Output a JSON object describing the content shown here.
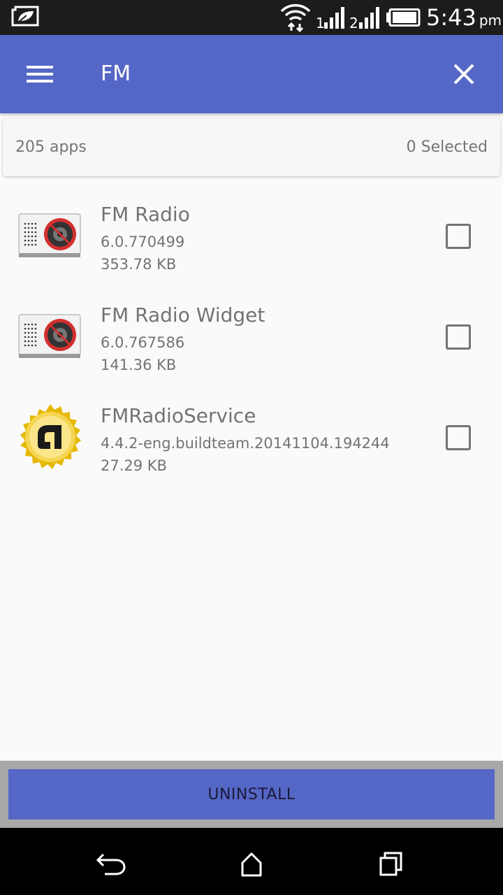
{
  "status_bar": {
    "time": "5:43",
    "ampm": "pm",
    "icons": [
      "leaf-icon",
      "wifi-icon",
      "signal-1-icon",
      "signal-2-icon",
      "battery-icon"
    ]
  },
  "app_bar": {
    "title": "FM",
    "menu_icon": "hamburger-menu-icon",
    "close_icon": "close-icon",
    "color": "#5567c6"
  },
  "summary": {
    "app_count": "205 apps",
    "selected_count": "0 Selected"
  },
  "apps": [
    {
      "name": "FM Radio",
      "version": "6.0.770499",
      "size": "353.78 KB",
      "icon": "fm-radio-icon",
      "checked": false
    },
    {
      "name": "FM Radio Widget",
      "version": "6.0.767586",
      "size": "141.36 KB",
      "icon": "fm-radio-icon",
      "checked": false
    },
    {
      "name": "FMRadioService",
      "version": "4.4.2-eng.buildteam.20141104.194244",
      "size": "27.29 KB",
      "icon": "android-gold-badge-icon",
      "checked": false
    }
  ],
  "actions": {
    "uninstall_label": "UNINSTALL"
  },
  "nav_bar": {
    "icons": [
      "back-icon",
      "home-icon",
      "recents-icon"
    ]
  }
}
